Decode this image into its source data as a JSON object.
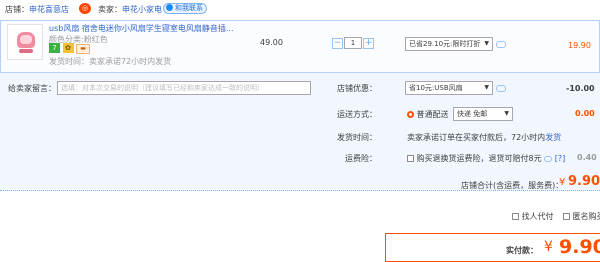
{
  "shop": {
    "label": "店铺：",
    "name": "申花喜意店",
    "seller_label": "卖家：",
    "seller_name": "申花小家电",
    "contact_badge": "和我联系"
  },
  "item": {
    "title": "usb风扇 宿舍电迷你小风扇学生寝室电风扇静音插...",
    "variant": "颜色分类:粉红色",
    "tag_seven": "7",
    "tag_quality": "✿",
    "ship_time": "发货时间：卖家承诺72小时内发货",
    "unit_price": "49.00",
    "quantity": "1",
    "qty_minus": "−",
    "qty_plus": "+",
    "promo_select": "已省29.10元:限时打折",
    "subtotal": "19.90"
  },
  "message": {
    "label": "给卖家留言：",
    "placeholder": "选填：对本次交易的说明（建议填写已经和卖家达成一致的说明）"
  },
  "shop_discount": {
    "label": "店铺优惠：",
    "select": "省10元:USB风扇",
    "amount": "-10.00"
  },
  "shipping": {
    "label": "运送方式：",
    "method": "普通配送",
    "select": "快递 免邮",
    "amount": "0.00"
  },
  "ship_time": {
    "label": "发货时间：",
    "text": "卖家承诺订单在买家付款后，72小时内",
    "link": "发货"
  },
  "insurance": {
    "label": "运费险：",
    "text": "购买退换货运费险，退货可赔付8元",
    "help": "[?]",
    "amount": "0.40"
  },
  "shop_total": {
    "label": "店铺合计(含运费，服务费)：",
    "currency": "¥",
    "value": "9.90"
  },
  "options": {
    "proxy_pay": "找人代付",
    "anonymous": "匿名购买"
  },
  "pay": {
    "label": "实付款：",
    "currency": "¥",
    "value": "9.90"
  },
  "colors": {
    "accent": "#ff5000",
    "link": "#3366cc",
    "row_bg": "#f2f7ff"
  }
}
